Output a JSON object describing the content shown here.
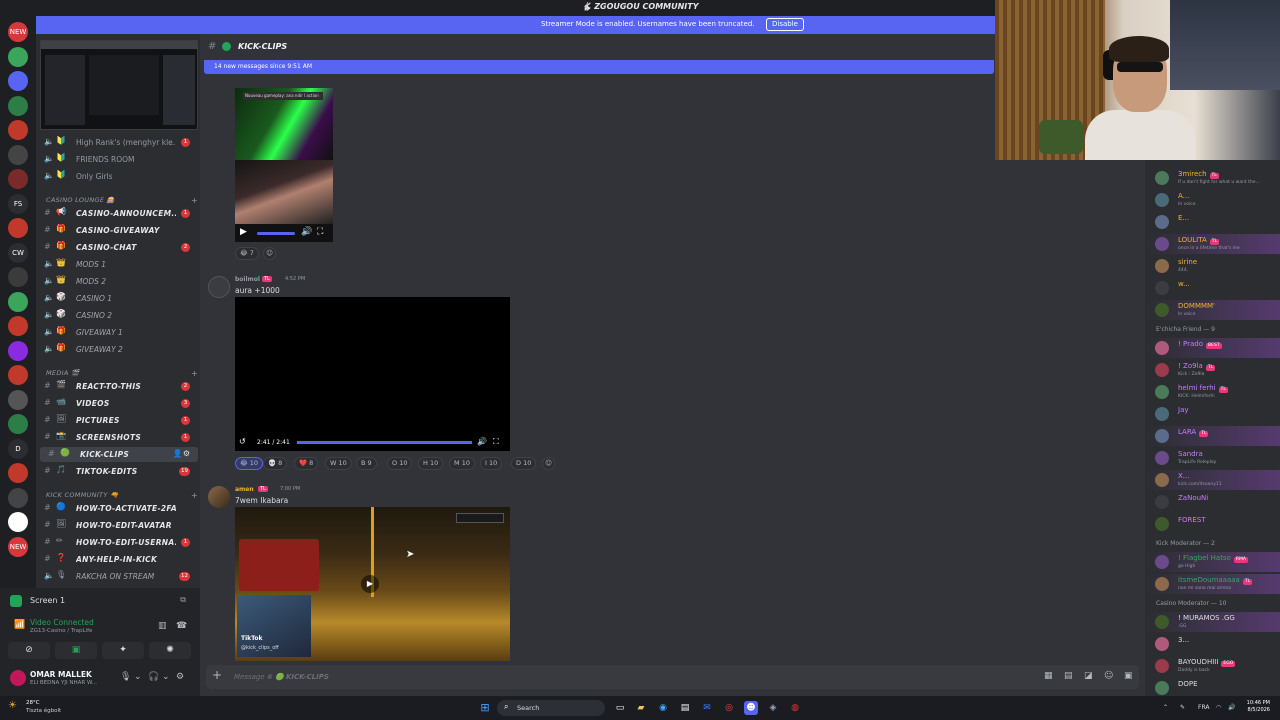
{
  "window": {
    "title": "ZGOUGOU COMMUNITY"
  },
  "banner": {
    "text": "Streamer Mode is enabled. Usernames have been truncated.",
    "button": "Disable"
  },
  "rail": {
    "items": [
      {
        "label": "NEW",
        "color": "#da373c"
      },
      {
        "label": "",
        "color": "#3ba55c",
        "badge": ""
      },
      {
        "label": "",
        "color": "#5865f2"
      },
      {
        "label": "",
        "color": "#2d7d46",
        "badge": "23"
      },
      {
        "label": "",
        "color": "#c0392b",
        "badge": "164"
      },
      {
        "label": "",
        "color": "#444",
        "badge": ""
      },
      {
        "label": "",
        "color": "#7a2a2a",
        "badge": "269"
      },
      {
        "label": "FS",
        "color": "#2b2d31"
      },
      {
        "label": "",
        "color": "#c0392b",
        "badge": "306"
      },
      {
        "label": "CW",
        "color": "#2b2d31"
      },
      {
        "label": "",
        "color": "#3b3b3b",
        "badge": "14"
      },
      {
        "label": "",
        "color": "#3ba55c",
        "badge": "662"
      },
      {
        "label": "",
        "color": "#c0392b",
        "badge": "904"
      },
      {
        "label": "",
        "color": "#8a2be2"
      },
      {
        "label": "",
        "color": "#c0392b",
        "badge": "1K+"
      },
      {
        "label": "",
        "color": "#555",
        "badge": "192"
      },
      {
        "label": "",
        "color": "#2d7d46",
        "badge": "273"
      },
      {
        "label": "D",
        "color": "#2b2d31"
      },
      {
        "label": "",
        "color": "#c0392b"
      },
      {
        "label": "",
        "color": "#444",
        "badge": "305"
      },
      {
        "label": "",
        "color": "#fff"
      },
      {
        "label": "NEW",
        "color": "#da373c"
      }
    ]
  },
  "sidebar": {
    "voice_channels_top": [
      {
        "emoji": "🔰",
        "name": "High Rank's (menghyr kle...",
        "count": "1"
      },
      {
        "emoji": "🔰",
        "name": "FRIENDS ROOM",
        "count": ""
      },
      {
        "emoji": "🔰",
        "name": "Only Girls",
        "count": ""
      }
    ],
    "categories": [
      {
        "name": "CASINO LOUNGE 🎰"
      },
      {
        "name": "MEDIA 🎬"
      },
      {
        "name": "KICK COMMUNITY 🔫"
      }
    ],
    "casino_channels": [
      {
        "type": "text",
        "emoji": "📢",
        "name": "CASINO-ANNOUNCEM...",
        "count": "1"
      },
      {
        "type": "text",
        "emoji": "🎁",
        "name": "CASINO-GIVEAWAY",
        "count": ""
      },
      {
        "type": "text",
        "emoji": "🎁",
        "name": "CASINO-CHAT",
        "count": "2"
      },
      {
        "type": "voice",
        "emoji": "👑",
        "name": "MODS 1",
        "count": ""
      },
      {
        "type": "voice",
        "emoji": "👑",
        "name": "MODS 2",
        "count": ""
      },
      {
        "type": "voice",
        "emoji": "🎲",
        "name": "CASINO 1",
        "count": ""
      },
      {
        "type": "voice",
        "emoji": "🎲",
        "name": "CASINO 2",
        "count": ""
      },
      {
        "type": "voice",
        "emoji": "🎁",
        "name": "GIVEAWAY 1",
        "count": ""
      },
      {
        "type": "voice",
        "emoji": "🎁",
        "name": "GIVEAWAY 2",
        "count": ""
      }
    ],
    "media_channels": [
      {
        "type": "text",
        "emoji": "🎬",
        "name": "REACT-TO-THIS",
        "count": "2"
      },
      {
        "type": "text",
        "emoji": "📹",
        "name": "VIDEOS",
        "count": "3"
      },
      {
        "type": "text",
        "emoji": "🖼",
        "name": "PICTURES",
        "count": "1"
      },
      {
        "type": "text",
        "emoji": "📸",
        "name": "SCREENSHOTS",
        "count": "1"
      },
      {
        "type": "text",
        "emoji": "🟢",
        "name": "KICK-CLIPS",
        "count": "",
        "active": true
      },
      {
        "type": "text",
        "emoji": "🎵",
        "name": "TIKTOK-EDITS",
        "count": "19"
      }
    ],
    "kick_channels": [
      {
        "type": "text",
        "emoji": "🔵",
        "name": "HOW-TO-ACTIVATE-2FA",
        "count": ""
      },
      {
        "type": "text",
        "emoji": "🖼",
        "name": "HOW-TO-EDIT-AVATAR",
        "count": ""
      },
      {
        "type": "text",
        "emoji": "✏",
        "name": "HOW-TO-EDIT-USERNA...",
        "count": "1"
      },
      {
        "type": "text",
        "emoji": "❓",
        "name": "ANY-HELP-IN-KICK",
        "count": ""
      },
      {
        "type": "voice",
        "emoji": "🎙",
        "name": "RAKCHA ON STREAM",
        "count": "12"
      }
    ]
  },
  "voice_panel": {
    "screen_label": "Screen 1",
    "status": "Video Connected",
    "location": "ZG13-Casino / TrapLife",
    "user_name": "OMAR MALLEK",
    "user_status": "ELI BEDNA YJI NHAR W..."
  },
  "chat": {
    "channel": "KICK-CLIPS",
    "new_messages": "14 new messages since 9:51 AM",
    "msg0_image_caption": "Nouveau gameplay: ana ndir l action mta3 ...",
    "msg0_reactions": [
      {
        "emoji": "😂",
        "count": "7"
      }
    ],
    "msg1": {
      "author": "boilmol",
      "tag": "TL",
      "time": "4:52 PM",
      "text": "aura +1000"
    },
    "video_time": "2:41 / 2:41",
    "msg1_reactions": [
      {
        "emoji": "😂",
        "count": "10",
        "me": true
      },
      {
        "emoji": "💀",
        "count": "8"
      },
      {
        "emoji": "❤️",
        "count": "8"
      },
      {
        "emoji": "W",
        "count": "10"
      },
      {
        "emoji": "B",
        "count": "9"
      },
      {
        "emoji": "O",
        "count": "10"
      },
      {
        "emoji": "H",
        "count": "10"
      },
      {
        "emoji": "M",
        "count": "10"
      },
      {
        "emoji": "I",
        "count": "10"
      },
      {
        "emoji": "D",
        "count": "10"
      }
    ],
    "msg2": {
      "author": "amen",
      "tag": "TL",
      "time": "7:00 PM",
      "text": "7wem Ikabara"
    },
    "video3_watermark": "TikTok",
    "video3_handle": "@kick_clips_off",
    "composer_prefix": "Message #",
    "composer_channel": "KICK-CLIPS"
  },
  "members": {
    "in_voice": [
      {
        "name": "3mirech",
        "tag": "TL",
        "status": "If u don't fight for what u want the...",
        "color": "#f0b232"
      },
      {
        "name": "A...",
        "tag": "",
        "status": "In voice",
        "color": "#f0b232"
      },
      {
        "name": "E...",
        "tag": "",
        "status": "",
        "color": "#f0b232"
      },
      {
        "name": "LOULITA",
        "tag": "TL",
        "status": "once in a lifetime that's me",
        "color": "#f0b232"
      },
      {
        "name": "sirine",
        "tag": "",
        "status": "444.",
        "color": "#f0b232"
      },
      {
        "name": "w...",
        "tag": "",
        "status": "",
        "color": "#f0b232"
      },
      {
        "name": "DOMMMM'",
        "tag": "",
        "status": "In voice",
        "color": "#f0b232"
      }
    ],
    "group1_title": "E'chicha Friend — 9",
    "group1": [
      {
        "name": "! Prado",
        "tag": "BEST",
        "status": "",
        "color": "#c77dff"
      },
      {
        "name": "! Zo9la",
        "tag": "TL",
        "status": "Kick : Zo9la",
        "color": "#c77dff"
      },
      {
        "name": "helmi ferhi",
        "tag": "TL",
        "status": "KICK: Helmiferhi",
        "color": "#c77dff"
      },
      {
        "name": "Jay",
        "tag": "",
        "status": "",
        "color": "#c77dff"
      },
      {
        "name": "LARA",
        "tag": "TL",
        "status": "",
        "color": "#c77dff"
      },
      {
        "name": "Sandra",
        "tag": "",
        "status": "TrapLife Roleplay",
        "color": "#c77dff"
      },
      {
        "name": "X...",
        "tag": "",
        "status": "kick.com/itsoony11",
        "color": "#c77dff"
      },
      {
        "name": "ZaNouNi",
        "tag": "",
        "status": "",
        "color": "#c77dff"
      },
      {
        "name": "FOREST",
        "tag": "",
        "status": "",
        "color": "#c77dff"
      }
    ],
    "group2_title": "Kick Moderator — 2",
    "group2": [
      {
        "name": "! Flagbel Hatso",
        "tag": "RMA",
        "status": "go High",
        "color": "#3ba55c"
      },
      {
        "name": "itsmeDoumaaaaa",
        "tag": "TL",
        "status": "non mi sono mai arresa",
        "color": "#3ba55c"
      }
    ],
    "group3_title": "Casino Moderator — 10",
    "group3": [
      {
        "name": "! MURAMOS .GG",
        "tag": "",
        "status": ".GG",
        "color": "#dbdee1"
      },
      {
        "name": "3...",
        "tag": "",
        "status": "",
        "color": "#dbdee1"
      },
      {
        "name": "BAYOUDHIII",
        "tag": "EGO",
        "status": "Daddy is back",
        "color": "#dbdee1"
      },
      {
        "name": "DOPE",
        "tag": "",
        "status": "",
        "color": "#dbdee1"
      }
    ]
  },
  "taskbar": {
    "weather_temp": "28°C",
    "weather_desc": "Tiszta égbolt",
    "search": "Search",
    "lang": "FRA",
    "time": "10:46 PM",
    "date": "8/5/2026"
  }
}
